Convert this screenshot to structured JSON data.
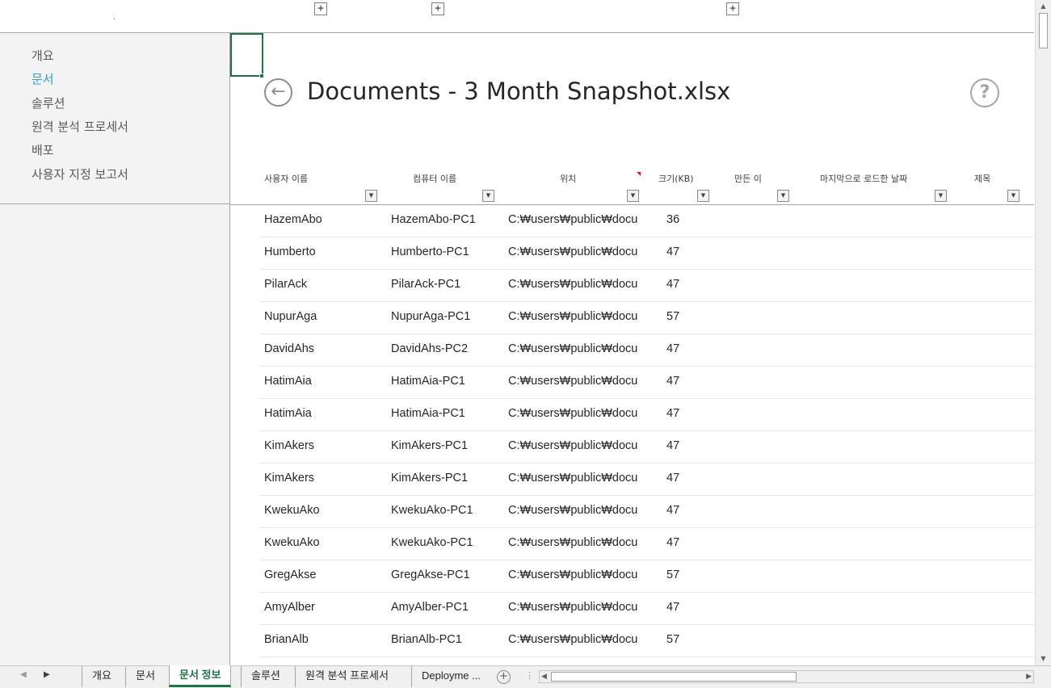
{
  "left_pane": {
    "nav": [
      {
        "label": "개요"
      },
      {
        "label": "문서"
      },
      {
        "label": "솔루션"
      },
      {
        "label": "원격 분석 프로세서"
      },
      {
        "label": "배포"
      },
      {
        "label": "사용자 지정 보고서"
      }
    ],
    "active_index": 1,
    "active_color": "#2e9bd6"
  },
  "title": "Documents - 3 Month Snapshot.xlsx",
  "icons": {
    "back": "back-arrow-icon",
    "help": "help-question-icon",
    "filter": "filter-dropdown-icon"
  },
  "columns": [
    {
      "label": "사용자 이름"
    },
    {
      "label": "컴퓨터 이름"
    },
    {
      "label": "위치"
    },
    {
      "label": "크기(KB)"
    },
    {
      "label": "만든 이"
    },
    {
      "label": "마지막으로 로드한 날짜"
    },
    {
      "label": "제목"
    }
  ],
  "rows": [
    {
      "user": "HazemAbo",
      "computer": "HazemAbo-PC1",
      "location": "C:₩users₩public₩docu",
      "size": "36"
    },
    {
      "user": "Humberto",
      "computer": "Humberto-PC1",
      "location": "C:₩users₩public₩docu",
      "size": "47"
    },
    {
      "user": "PilarAck",
      "computer": "PilarAck-PC1",
      "location": "C:₩users₩public₩docu",
      "size": "47"
    },
    {
      "user": "NupurAga",
      "computer": "NupurAga-PC1",
      "location": "C:₩users₩public₩docu",
      "size": "57"
    },
    {
      "user": "DavidAhs",
      "computer": "DavidAhs-PC2",
      "location": "C:₩users₩public₩docu",
      "size": "47"
    },
    {
      "user": "HatimAia",
      "computer": "HatimAia-PC1",
      "location": "C:₩users₩public₩docu",
      "size": "47"
    },
    {
      "user": "HatimAia",
      "computer": "HatimAia-PC1",
      "location": "C:₩users₩public₩docu",
      "size": "47"
    },
    {
      "user": "KimAkers",
      "computer": "KimAkers-PC1",
      "location": "C:₩users₩public₩docu",
      "size": "47"
    },
    {
      "user": "KimAkers",
      "computer": "KimAkers-PC1",
      "location": "C:₩users₩public₩docu",
      "size": "47"
    },
    {
      "user": "KwekuAko",
      "computer": "KwekuAko-PC1",
      "location": "C:₩users₩public₩docu",
      "size": "47"
    },
    {
      "user": "KwekuAko",
      "computer": "KwekuAko-PC1",
      "location": "C:₩users₩public₩docu",
      "size": "47"
    },
    {
      "user": "GregAkse",
      "computer": "GregAkse-PC1",
      "location": "C:₩users₩public₩docu",
      "size": "57"
    },
    {
      "user": "AmyAlber",
      "computer": "AmyAlber-PC1",
      "location": "C:₩users₩public₩docu",
      "size": "47"
    },
    {
      "user": "BrianAlb",
      "computer": "BrianAlb-PC1",
      "location": "C:₩users₩public₩docu",
      "size": "57"
    }
  ],
  "sheet_tabs": [
    {
      "label": "개요"
    },
    {
      "label": "문서"
    },
    {
      "label": "문서 정보"
    },
    {
      "label": "솔루션"
    },
    {
      "label": "원격 분석 프로세서"
    },
    {
      "label": "Deployme ..."
    }
  ],
  "active_tab_index": 2,
  "accent_color": "#217346",
  "sort_indicator_color": "#e81123"
}
